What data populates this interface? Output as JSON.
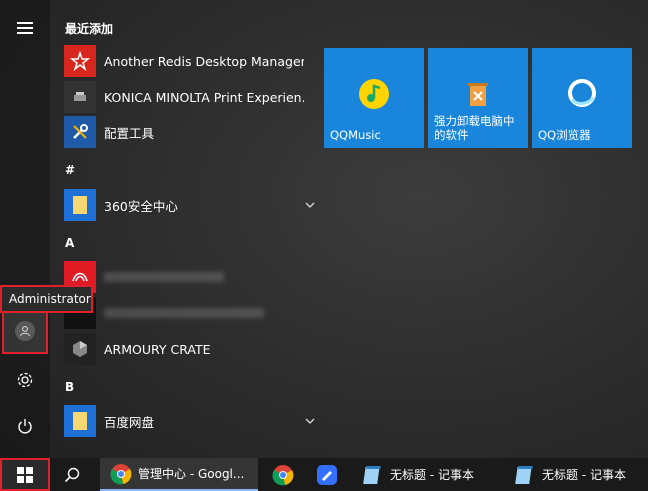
{
  "recently_added_header": "最近添加",
  "apps": [
    {
      "label": "Another Redis Desktop Manager",
      "icon": "redis-icon"
    },
    {
      "label": "KONICA MINOLTA Print Experien...",
      "icon": "konica-icon"
    },
    {
      "label": "配置工具",
      "icon": "tools-icon"
    }
  ],
  "group_hash": "#",
  "app_360": {
    "label": "360安全中心",
    "icon": "folder-icon"
  },
  "group_a": "A",
  "app_armoury": {
    "label": "ARMOURY CRATE",
    "icon": "armoury-icon"
  },
  "group_b": "B",
  "app_baidu": {
    "label": "百度网盘",
    "icon": "folder-icon"
  },
  "user_tooltip": "Administrator",
  "tiles": [
    {
      "label": "QQMusic",
      "icon": "qqmusic-icon"
    },
    {
      "label": "强力卸载电脑中的软件",
      "icon": "uninstall-icon"
    },
    {
      "label": "QQ浏览器",
      "icon": "qqbrowser-icon"
    }
  ],
  "taskbar": {
    "items": [
      {
        "label": "管理中心 - Googl...",
        "icon": "chrome-icon"
      },
      {
        "label": "",
        "icon": "chrome-icon"
      },
      {
        "label": "",
        "icon": "feishu-icon"
      },
      {
        "label": "无标题 - 记事本",
        "icon": "notepad-icon"
      },
      {
        "label": "无标题 - 记事本",
        "icon": "notepad-icon"
      }
    ]
  },
  "colors": {
    "accent": "#1a86db",
    "highlight": "#e0202a"
  }
}
